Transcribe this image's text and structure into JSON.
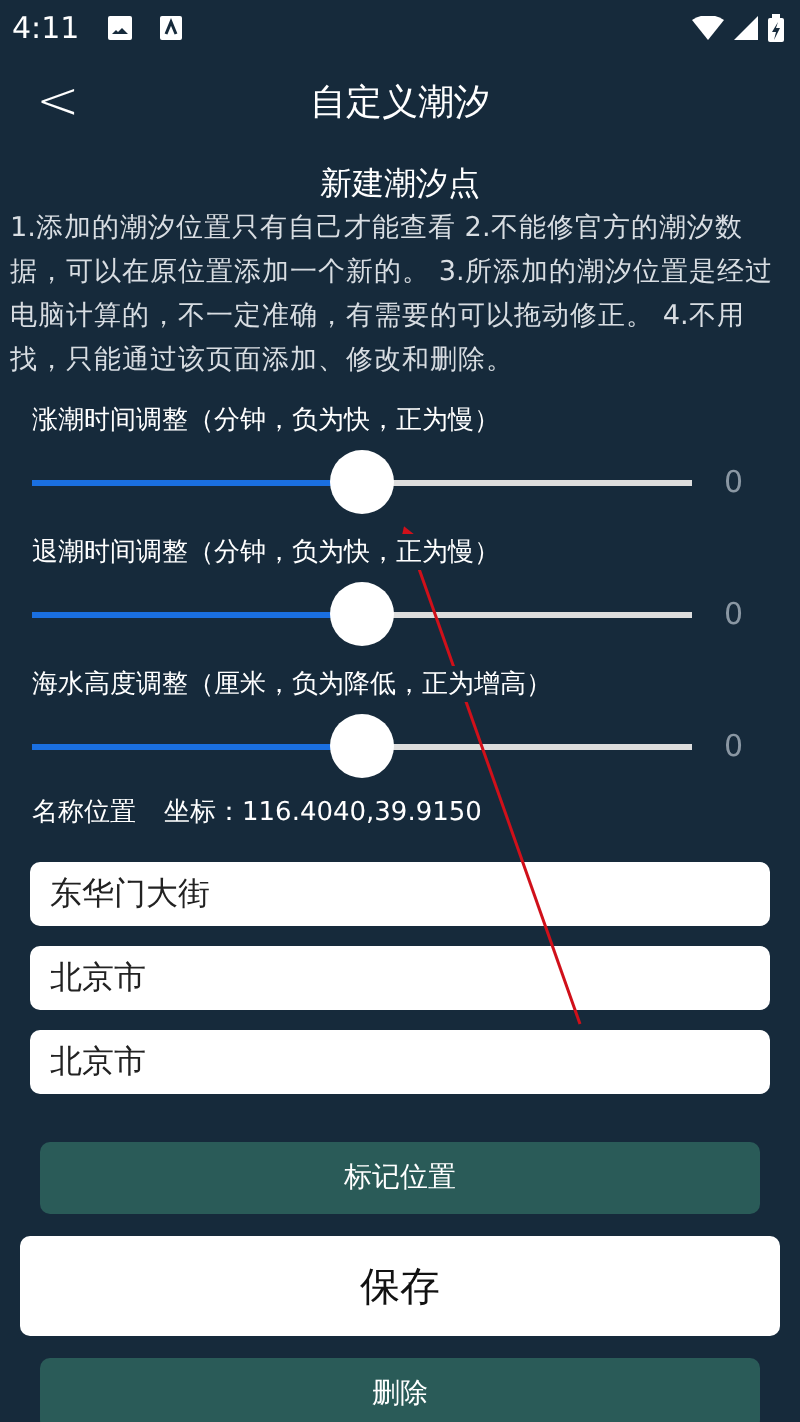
{
  "status_bar": {
    "time": "4:11"
  },
  "header": {
    "back": "<",
    "title": "自定义潮汐"
  },
  "section_title": "新建潮汐点",
  "notice": "1.添加的潮汐位置只有自己才能查看 2.不能修官方的潮汐数据，可以在原位置添加一个新的。 3.所添加的潮汐位置是经过电脑计算的，不一定准确，有需要的可以拖动修正。 4.不用找，只能通过该页面添加、修改和删除。",
  "sliders": [
    {
      "label": "涨潮时间调整（分钟，负为快，正为慢）",
      "level": 0.5,
      "reading": "0"
    },
    {
      "label": "退潮时间调整（分钟，负为快，正为慢）",
      "level": 0.5,
      "reading": "0"
    },
    {
      "label": "海水高度调整（厘米，负为降低，正为增高）",
      "level": 0.5,
      "reading": "0"
    }
  ],
  "location": {
    "label": "名称位置",
    "coords": "坐标：116.4040,39.9150"
  },
  "fields": [
    {
      "value": "东华门大街"
    },
    {
      "value": "北京市"
    },
    {
      "value": "北京市"
    }
  ],
  "buttons": [
    {
      "label": "标记位置",
      "kind": "secondary"
    },
    {
      "label": "保存",
      "kind": "primary"
    },
    {
      "label": "删除",
      "kind": "secondary"
    }
  ]
}
